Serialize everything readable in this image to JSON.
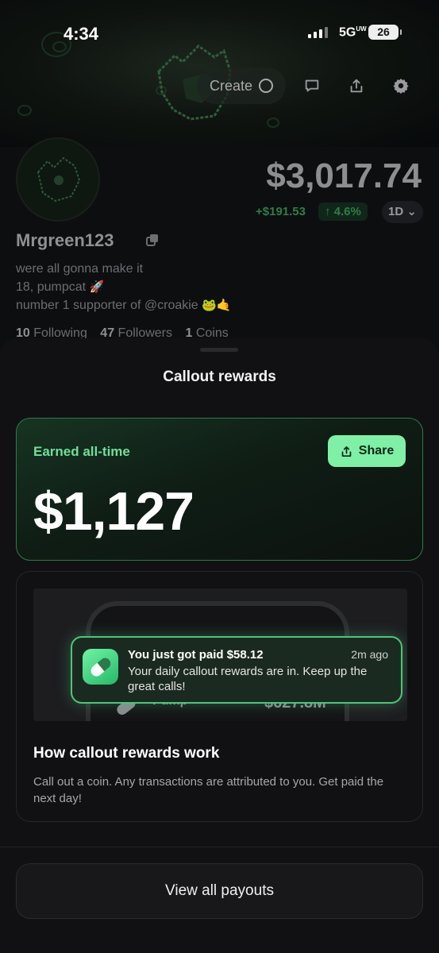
{
  "status_bar": {
    "time": "4:34",
    "network": "5G",
    "network_sup": "UW",
    "battery": "26"
  },
  "header": {
    "create_label": "Create"
  },
  "profile": {
    "balance": "$3,017.74",
    "change": "+$191.53",
    "change_pct": "↑ 4.6%",
    "range": "1D",
    "username": "Mrgreen123",
    "bio": [
      "were all gonna make it",
      "18, pumpcat",
      "number 1 supporter of @croakie"
    ],
    "bio_emoji": [
      "🚀",
      "🐸🤙"
    ],
    "stats": {
      "following_count": "10",
      "following_label": "Following",
      "followers_count": "47",
      "followers_label": "Followers",
      "coins_count": "1",
      "coins_label": "Coins"
    }
  },
  "sheet": {
    "title": "Callout rewards",
    "earned": {
      "label": "Earned all-time",
      "amount": "$1,127",
      "share_label": "Share"
    },
    "preview": {
      "notification_title": "You just got paid $58.12",
      "notification_time": "2m ago",
      "notification_body": "Your daily callout rewards are in. Keep up the great calls!",
      "coin_name": "Pump",
      "coin_value": "$627.8M"
    },
    "how": {
      "title": "How callout rewards work",
      "description": "Call out a coin. Any transactions are attributed to you. Get paid the next day!"
    },
    "payouts_label": "View all payouts"
  },
  "colors": {
    "accent": "#7ff0a6",
    "accent_text": "#6fe09a",
    "positive": "#2f7d45",
    "background": "#111114"
  }
}
